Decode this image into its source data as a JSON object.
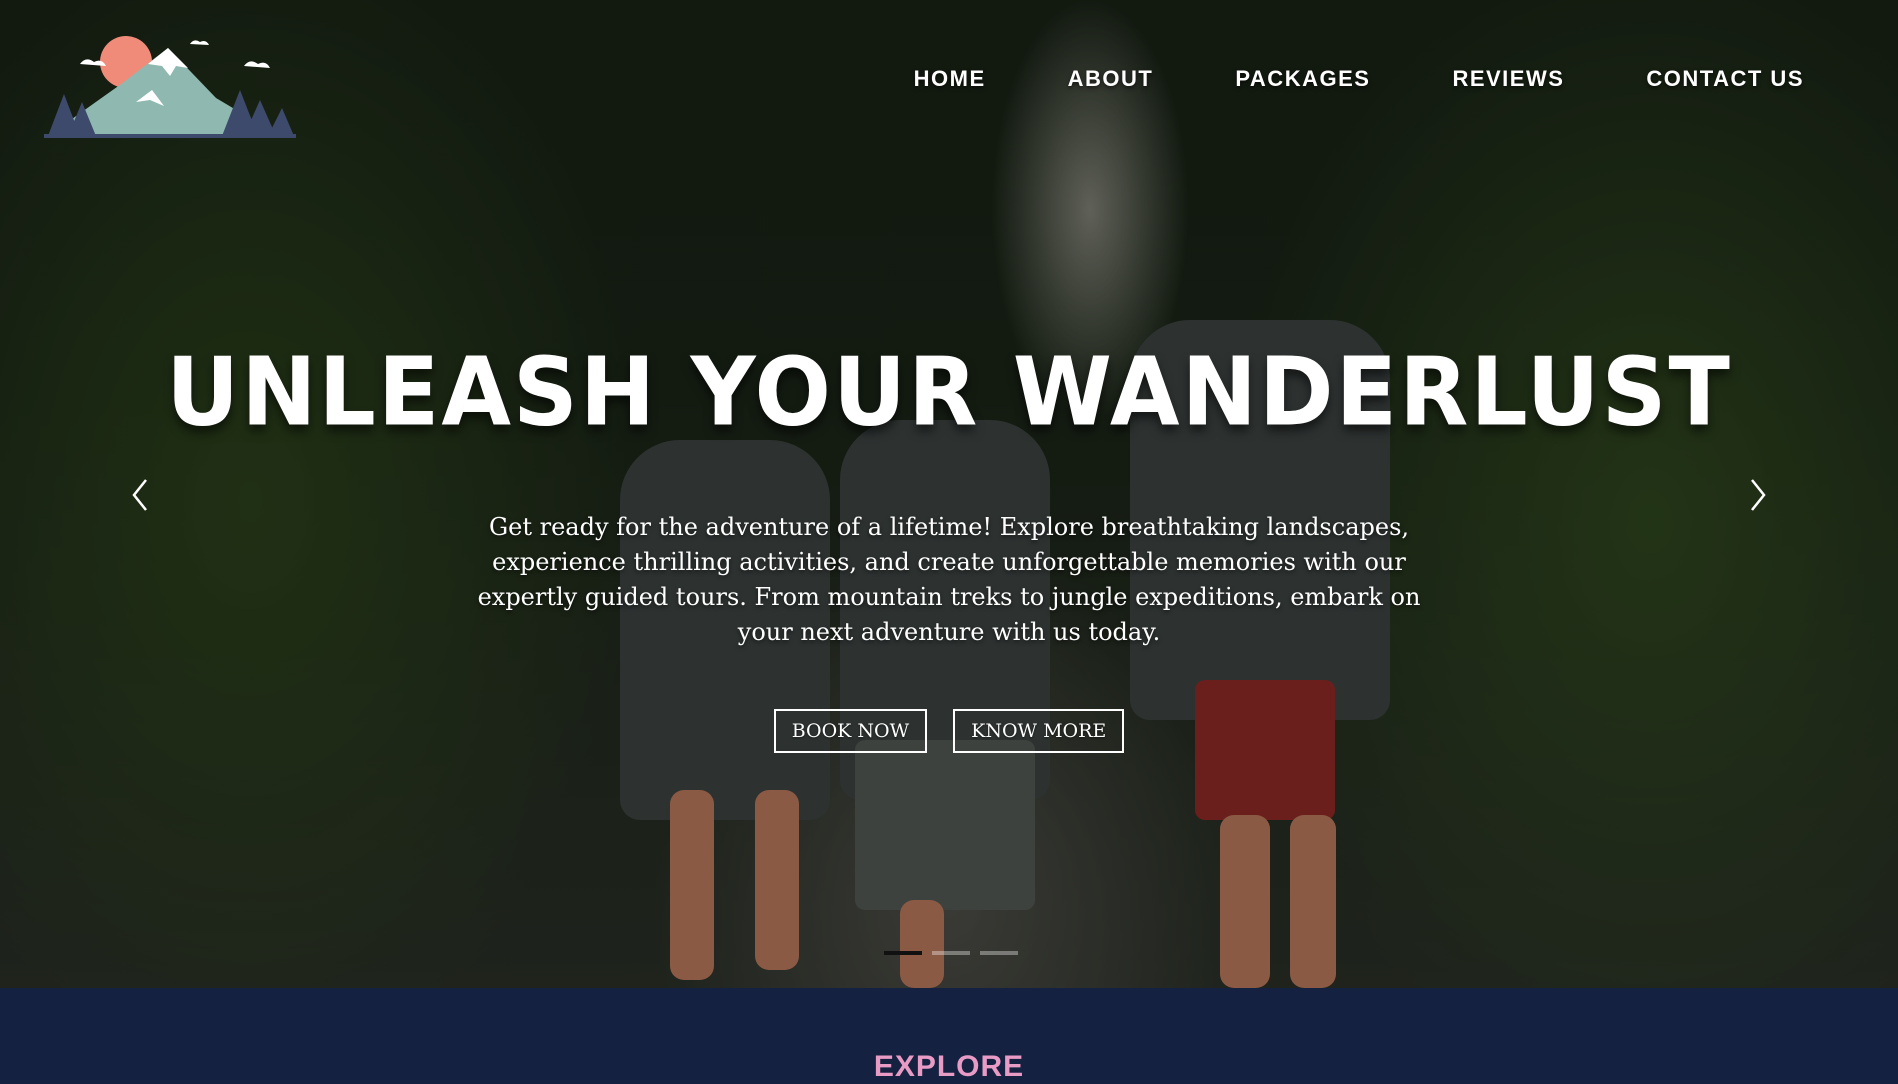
{
  "nav": {
    "items": [
      {
        "label": "HOME"
      },
      {
        "label": "ABOUT"
      },
      {
        "label": "PACKAGES"
      },
      {
        "label": "REVIEWS"
      },
      {
        "label": "CONTACT US"
      }
    ]
  },
  "hero": {
    "headline": "UNLEASH YOUR WANDERLUST",
    "description": "Get ready for the adventure of a lifetime! Explore breathtaking landscapes, experience thrilling activities, and create unforgettable memories with our expertly guided tours. From mountain treks to jungle expeditions, embark on your next adventure with us today.",
    "book_label": "BOOK NOW",
    "know_label": "KNOW MORE",
    "slides_total": 3,
    "active_slide": 1,
    "prev_icon": "chevron-left-icon",
    "next_icon": "chevron-right-icon"
  },
  "section": {
    "label": "EXPLORE"
  },
  "colors": {
    "band": "#142140",
    "accent_pink": "#e79bc5",
    "logo_sun": "#f08b7a",
    "logo_mountain": "#8fb9b0",
    "logo_trees": "#3d4a6b"
  }
}
